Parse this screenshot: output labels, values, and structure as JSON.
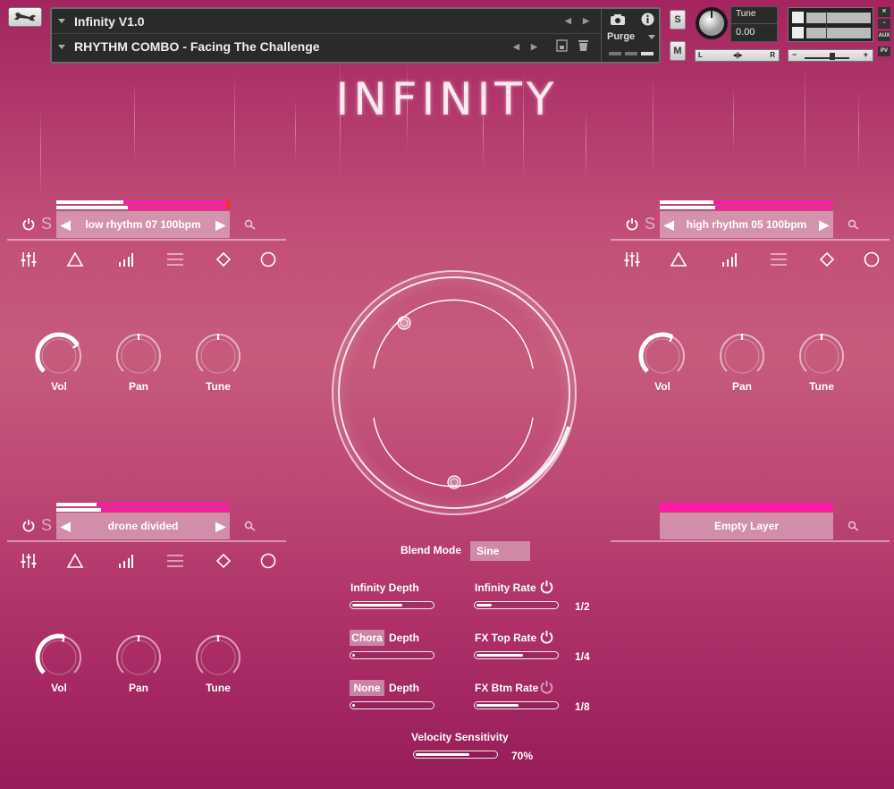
{
  "header": {
    "instrument_name": "Infinity V1.0",
    "snapshot_name": "RHYTHM COMBO - Facing The Challenge",
    "purge_label": "Purge",
    "solo_label": "S",
    "mute_label": "M",
    "tune_label": "Tune",
    "tune_value": "0.00",
    "pan_left": "L",
    "pan_right": "R",
    "vol_minus": "−",
    "vol_plus": "+",
    "aux_label": "AUX",
    "pv_label": "PV"
  },
  "app_title": "INFINITY",
  "layers": [
    {
      "preset": "low rhythm 07 100bpm",
      "solo": "S",
      "knobs": [
        {
          "label": "Vol",
          "value": 0.72
        },
        {
          "label": "Pan",
          "value": 0.5
        },
        {
          "label": "Tune",
          "value": 0.5
        }
      ]
    },
    {
      "preset": "high rhythm 05 100bpm",
      "solo": "S",
      "knobs": [
        {
          "label": "Vol",
          "value": 0.6
        },
        {
          "label": "Pan",
          "value": 0.5
        },
        {
          "label": "Tune",
          "value": 0.5
        }
      ]
    },
    {
      "preset": "drone divided",
      "solo": "S",
      "knobs": [
        {
          "label": "Vol",
          "value": 0.55
        },
        {
          "label": "Pan",
          "value": 0.5
        },
        {
          "label": "Tune",
          "value": 0.5
        }
      ]
    },
    {
      "preset": "Empty Layer"
    }
  ],
  "blend": {
    "label": "Blend Mode",
    "value": "Sine"
  },
  "controls": {
    "infinity_depth": {
      "label": "Infinity Depth",
      "value": 0.65
    },
    "infinity_rate": {
      "label": "Infinity Rate",
      "value": 0.2,
      "display": "1/2"
    },
    "chorus_type": "Chora",
    "chorus_depth": {
      "label": "Depth",
      "value": 0.02
    },
    "fx_top_rate": {
      "label": "FX Top Rate",
      "value": 0.6,
      "display": "1/4"
    },
    "fx_btm_type": "None",
    "fx_btm_depth": {
      "label": "Depth",
      "value": 0.02
    },
    "fx_btm_rate": {
      "label": "FX Btm Rate",
      "value": 0.55,
      "display": "1/8"
    },
    "velocity": {
      "label": "Velocity Sensitivity",
      "value": 0.7,
      "display": "70%"
    }
  },
  "icons": [
    "wrench-icon",
    "camera-icon",
    "info-icon",
    "save-icon",
    "trash-icon",
    "power-icon",
    "magnifier-icon",
    "mixer-icon",
    "triangle-icon",
    "bars-icon",
    "menu-icon",
    "diamond-icon",
    "circle-icon"
  ]
}
